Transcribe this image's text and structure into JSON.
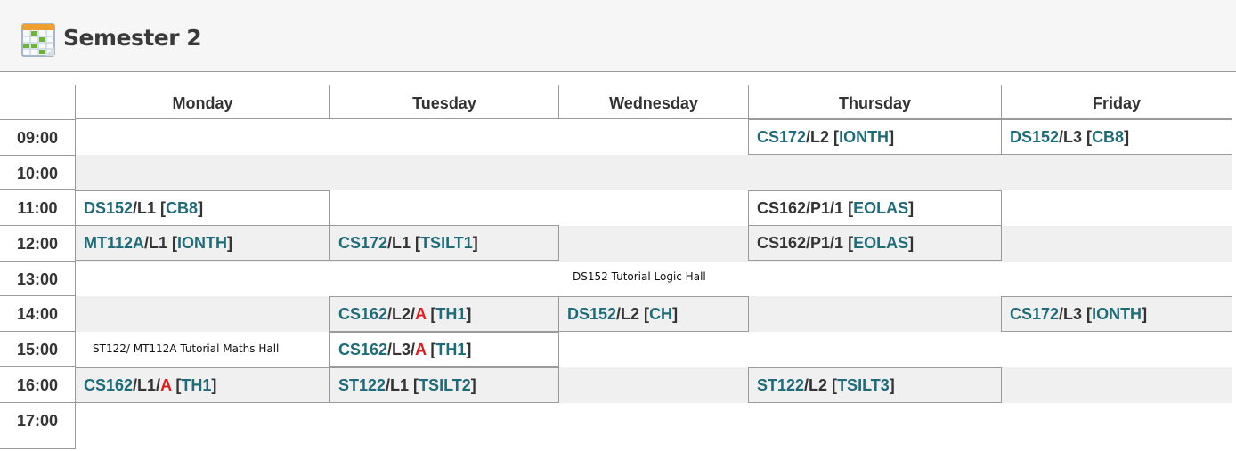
{
  "header": {
    "title": "Semester 2",
    "icon": "calendar-icon"
  },
  "days": [
    "Monday",
    "Tuesday",
    "Wednesday",
    "Thursday",
    "Friday"
  ],
  "times": [
    "09:00",
    "10:00",
    "11:00",
    "12:00",
    "13:00",
    "14:00",
    "15:00",
    "16:00",
    "17:00"
  ],
  "classes": [
    {
      "id": "thu-0900",
      "code": "CS172",
      "section": "/L2 [",
      "room": "IONTH",
      "close": "]"
    },
    {
      "id": "fri-0900",
      "code": "DS152",
      "section": "/L3 [",
      "room": "CB8",
      "close": "]"
    },
    {
      "id": "mon-1100",
      "code": "DS152",
      "section": "/L1 [",
      "room": "CB8",
      "close": "]"
    },
    {
      "id": "thu-1100",
      "code": "CS162/P1/1",
      "section": " [",
      "room": "EOLAS",
      "close": "]"
    },
    {
      "id": "mon-1200",
      "code": "MT112A",
      "section": "/L1 [",
      "room": "IONTH",
      "close": "]"
    },
    {
      "id": "tue-1200",
      "code": "CS172",
      "section": "/L1 [",
      "room": "TSILT1",
      "close": "]"
    },
    {
      "id": "thu-1200",
      "code": "CS162/P1/1",
      "section": " [",
      "room": "EOLAS",
      "close": "]"
    },
    {
      "id": "tue-1400",
      "code": "CS162",
      "section": "/L2/",
      "flag": "A",
      "sep": " [",
      "room": "TH1",
      "close": "]"
    },
    {
      "id": "wed-1400",
      "code": "DS152",
      "section": "/L2 [",
      "room": "CH",
      "close": "]"
    },
    {
      "id": "fri-1400",
      "code": "CS172",
      "section": "/L3 [",
      "room": "IONTH",
      "close": "]"
    },
    {
      "id": "tue-1500",
      "code": "CS162",
      "section": "/L3/",
      "flag": "A",
      "sep": " [",
      "room": "TH1",
      "close": "]"
    },
    {
      "id": "mon-1600",
      "code": "CS162",
      "section": "/L1/",
      "flag": "A",
      "sep": " [",
      "room": "TH1",
      "close": "]"
    },
    {
      "id": "tue-1600",
      "code": "ST122",
      "section": "/L1 [",
      "room": "TSILT2",
      "close": "]"
    },
    {
      "id": "thu-1600",
      "code": "ST122",
      "section": "/L2 [",
      "room": "TSILT3",
      "close": "]"
    }
  ],
  "notes": {
    "wed_1300": "DS152 Tutorial Logic Hall",
    "mon_1500": "ST122/ MT112A Tutorial Maths Hall"
  },
  "colors": {
    "code": "#1e6b79",
    "flag": "#e21c1c",
    "band": "#f0f0f0",
    "border": "#9a9a9a"
  }
}
